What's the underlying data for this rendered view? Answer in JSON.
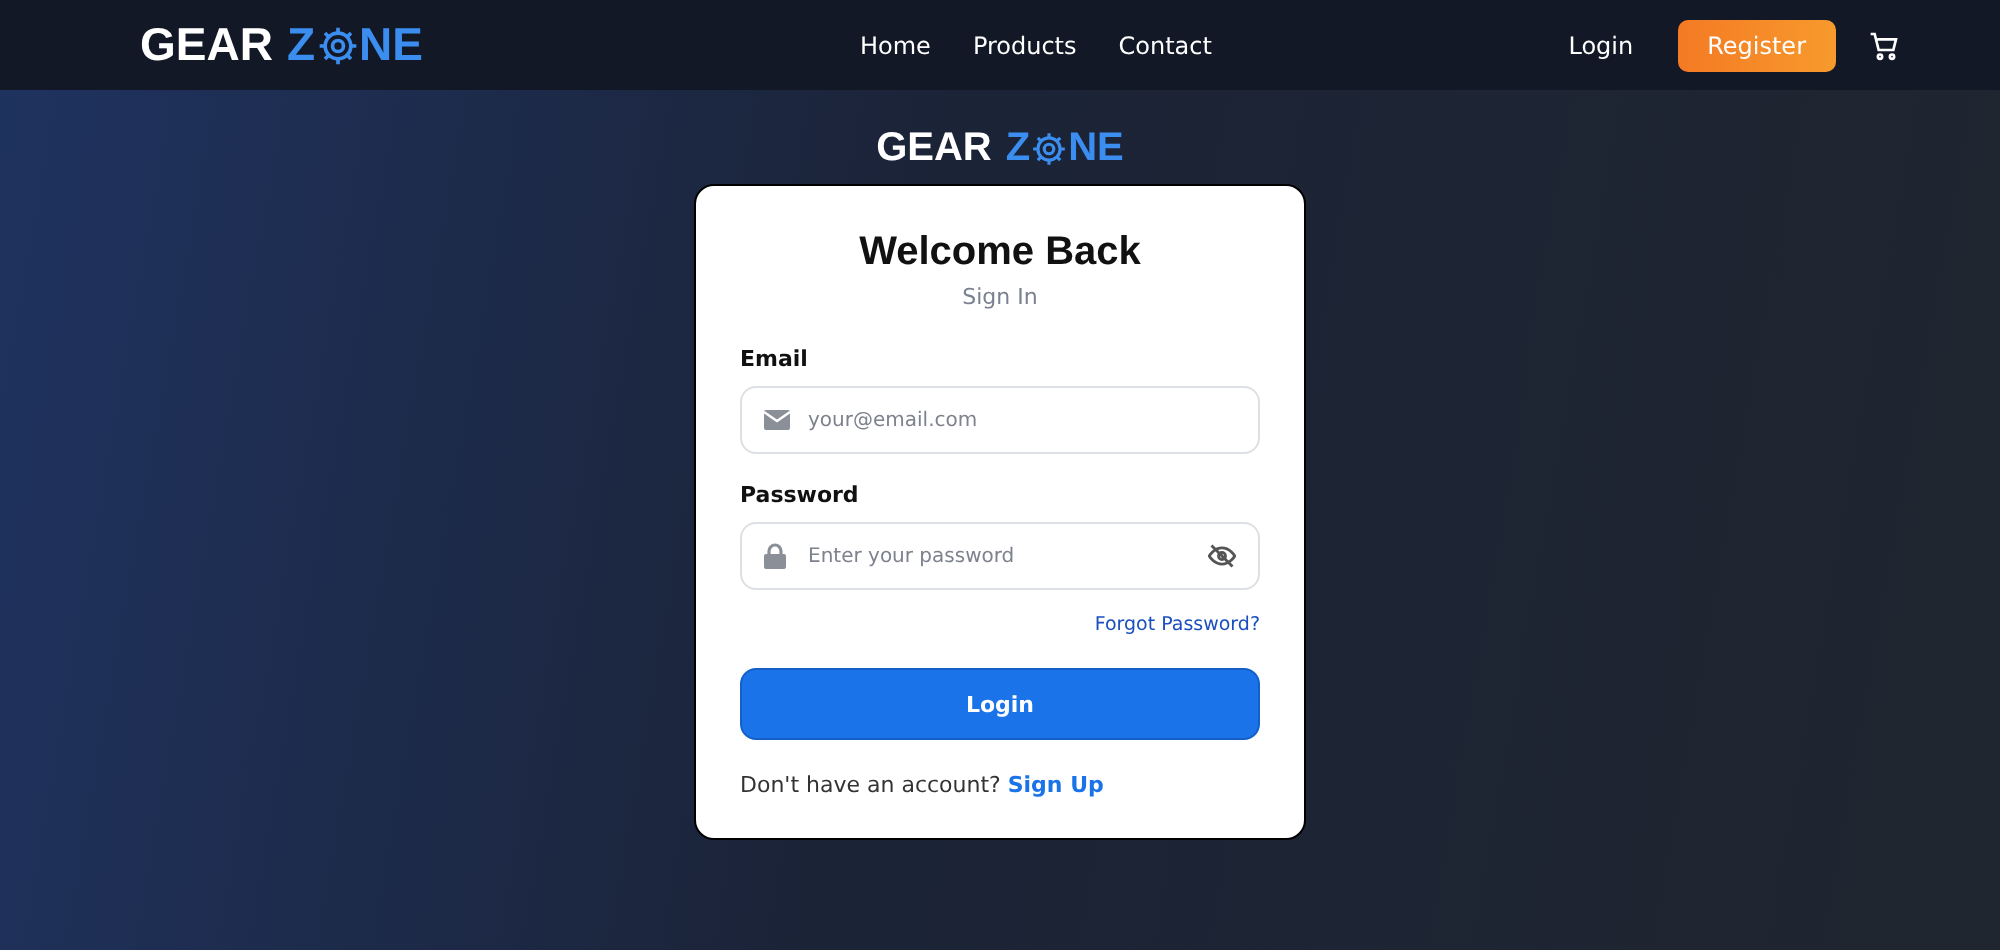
{
  "header": {
    "logo": {
      "word": "GEAR",
      "z": "Z",
      "rest": "NE"
    },
    "nav": [
      {
        "label": "Home"
      },
      {
        "label": "Products"
      },
      {
        "label": "Contact"
      }
    ],
    "login": "Login",
    "register": "Register"
  },
  "form_logo": {
    "word": "GEAR",
    "z": "Z",
    "rest": "NE"
  },
  "card": {
    "title": "Welcome Back",
    "subtitle": "Sign In",
    "fields": [
      {
        "kind": "email",
        "label": "Email",
        "placeholder": "your@email.com"
      },
      {
        "kind": "password",
        "label": "Password",
        "placeholder": "Enter your password"
      }
    ],
    "forgot": "Forgot Password?",
    "submit": "Login",
    "prompt": "Don't have an account?",
    "signup": "Sign Up"
  }
}
